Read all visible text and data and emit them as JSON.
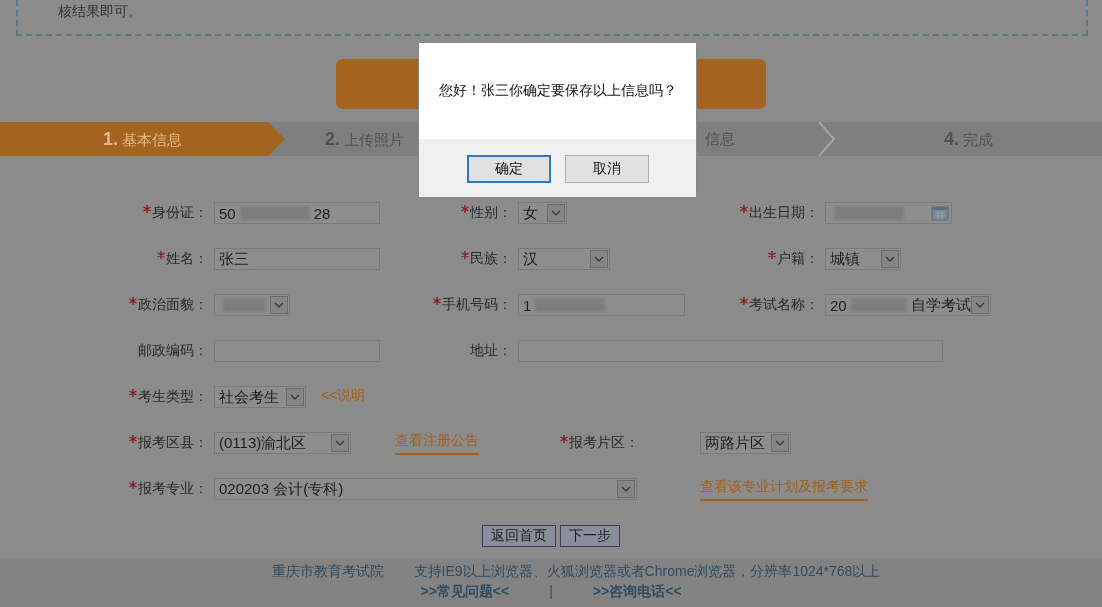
{
  "notice": {
    "text": "核结果即可。"
  },
  "steps": [
    {
      "number": "1.",
      "label": "基本信息",
      "selected": true
    },
    {
      "number": "2.",
      "label": "上传照片",
      "selected": false
    },
    {
      "label": "信息",
      "selected": false
    },
    {
      "number": "4.",
      "label": "完成",
      "selected": false
    }
  ],
  "form": {
    "rows": [
      [
        {
          "kind": "label",
          "text": "身份证：",
          "required": true
        },
        {
          "kind": "text",
          "value_parts": [
            "50",
            "28"
          ],
          "redacted": true
        },
        {
          "kind": "label",
          "text": "性别：",
          "required": true
        },
        {
          "kind": "select",
          "value_parts": [
            "女"
          ]
        },
        {
          "kind": "label",
          "text": "出生日期：",
          "required": true
        },
        {
          "kind": "date",
          "redacted": true
        }
      ],
      [
        {
          "kind": "label",
          "text": "姓名：",
          "required": true
        },
        {
          "kind": "text",
          "value_parts": [
            "张三"
          ]
        },
        {
          "kind": "label",
          "text": "民族：",
          "required": true
        },
        {
          "kind": "select",
          "value_parts": [
            "汉"
          ]
        },
        {
          "kind": "label",
          "text": "户籍：",
          "required": true
        },
        {
          "kind": "select",
          "value_parts": [
            "城镇"
          ]
        }
      ],
      [
        {
          "kind": "label",
          "text": "政治面貌：",
          "required": true
        },
        {
          "kind": "select",
          "redacted": true
        },
        {
          "kind": "label",
          "text": "手机号码：",
          "required": true
        },
        {
          "kind": "text",
          "value_parts": [
            "1"
          ],
          "redacted": true
        },
        {
          "kind": "label",
          "text": "考试名称：",
          "required": true
        },
        {
          "kind": "select",
          "value_parts": [
            "20",
            "自学考试"
          ],
          "redacted": true
        }
      ],
      [
        {
          "kind": "label",
          "text": "邮政编码：",
          "required": false
        },
        {
          "kind": "text"
        },
        {
          "kind": "label",
          "text": "地址：",
          "required": false
        },
        {
          "kind": "text"
        }
      ],
      [
        {
          "kind": "label",
          "text": "考生类型：",
          "required": true
        },
        {
          "kind": "select",
          "value_parts": [
            "社会考生"
          ]
        },
        {
          "kind": "link",
          "text": "<<说明",
          "underlined": false
        }
      ],
      [
        {
          "kind": "label",
          "text": "报考区县：",
          "required": true
        },
        {
          "kind": "select",
          "value_parts": [
            "(0113)渝北区"
          ]
        },
        {
          "kind": "link",
          "text": "查看注册公告",
          "underlined": true
        },
        {
          "kind": "label",
          "text": "报考片区：",
          "required": true
        },
        {
          "kind": "select",
          "value_parts": [
            "两路片区"
          ]
        }
      ],
      [
        {
          "kind": "label",
          "text": "报考专业：",
          "required": true
        },
        {
          "kind": "select",
          "value_parts": [
            "020203  会计(专科)"
          ]
        },
        "",
        "",
        {
          "kind": "link",
          "text": "查看该专业计划及报考要求",
          "underlined": true
        }
      ]
    ]
  },
  "actions": [
    "返回首页",
    "下一步"
  ],
  "footer": {
    "texts": [
      "重庆市教育考试院",
      "支持IE9以上浏览器、火狐浏览器或者Chrome浏览器，分辨率1024*768以上"
    ],
    "links": [
      ">>常见问题<<",
      ">>咨询电话<<"
    ],
    "separator": "|"
  },
  "dialog": {
    "message": "您好！张三你确定要保存以上信息吗？",
    "buttons": [
      {
        "label": "确定",
        "focused": true
      },
      {
        "label": "取消",
        "focused": false
      }
    ]
  }
}
